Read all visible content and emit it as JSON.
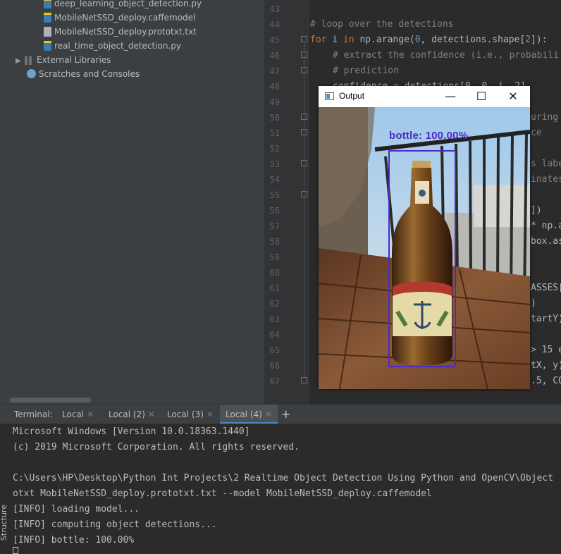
{
  "project_tree": {
    "items": [
      {
        "label": "deep_learning_object_detection.py",
        "icon": "python-file-icon"
      },
      {
        "label": "MobileNetSSD_deploy.caffemodel",
        "icon": "python-file-icon"
      },
      {
        "label": "MobileNetSSD_deploy.prototxt.txt",
        "icon": "text-file-icon"
      },
      {
        "label": "real_time_object_detection.py",
        "icon": "python-file-icon"
      },
      {
        "label": "External Libraries",
        "icon": "library-icon"
      },
      {
        "label": "Scratches and Consoles",
        "icon": "scratches-icon"
      }
    ]
  },
  "editor": {
    "line_numbers": [
      "43",
      "44",
      "45",
      "46",
      "47",
      "48",
      "49",
      "50",
      "51",
      "52",
      "53",
      "54",
      "55",
      "56",
      "57",
      "58",
      "59",
      "60",
      "61",
      "62",
      "63",
      "64",
      "65",
      "66",
      "67"
    ],
    "lines": {
      "l44": "# loop over the detections",
      "l45_kw": "for",
      "l45_mid1": " i ",
      "l45_kw2": "in",
      "l45_mid2": " np.arange(",
      "l45_num": "0",
      "l45_mid3": ", detections.shape[",
      "l45_num2": "2",
      "l45_end": "]):",
      "l46": "# extract the confidence (i.e., probabili",
      "l47": "# prediction",
      "l48": "confidence = detections[0, 0, i, 2]",
      "l50_frag": "uring",
      "l51_frag": "ce",
      "l53_frag": "s labe",
      "l54_frag": "inates",
      "l56_frag": "])",
      "l57_frag": "* np.a",
      "l58_frag": "box.as",
      "l61_frag": "ASSES[",
      "l62_frag": ")",
      "l63_frag": "tartY)",
      "l65_frag": "> 15 e",
      "l66_frag": "tX, y)",
      "l67_frag": ".5, CO"
    }
  },
  "output_window": {
    "title": "Output",
    "minimize": "—",
    "maximize": "☐",
    "close": "✕",
    "detection_label": "bottle: 100.00%"
  },
  "terminal": {
    "label": "Terminal:",
    "tabs": [
      "Local",
      "Local (2)",
      "Local (3)",
      "Local (4)"
    ],
    "active_tab": "Local (4)",
    "add_tab": "+",
    "lines": [
      "Microsoft Windows [Version 10.0.18363.1440]",
      "(c) 2019 Microsoft Corporation. All rights reserved.",
      "",
      "C:\\Users\\HP\\Desktop\\Python Int Projects\\2 Realtime Object Detection Using Python and OpenCV\\Object",
      "otxt MobileNetSSD_deploy.prototxt.txt --model MobileNetSSD_deploy.caffemodel",
      "[INFO] loading model...",
      "[INFO] computing object detections...",
      "[INFO] bottle: 100.00%"
    ]
  },
  "side_strip": {
    "structure_label": "Structure"
  },
  "colors": {
    "detection_box": "#4a2bc8",
    "editor_bg": "#2b2b2b",
    "panel_bg": "#3c3f41",
    "keyword": "#cc7832",
    "comment": "#808080",
    "number": "#6897bb"
  }
}
